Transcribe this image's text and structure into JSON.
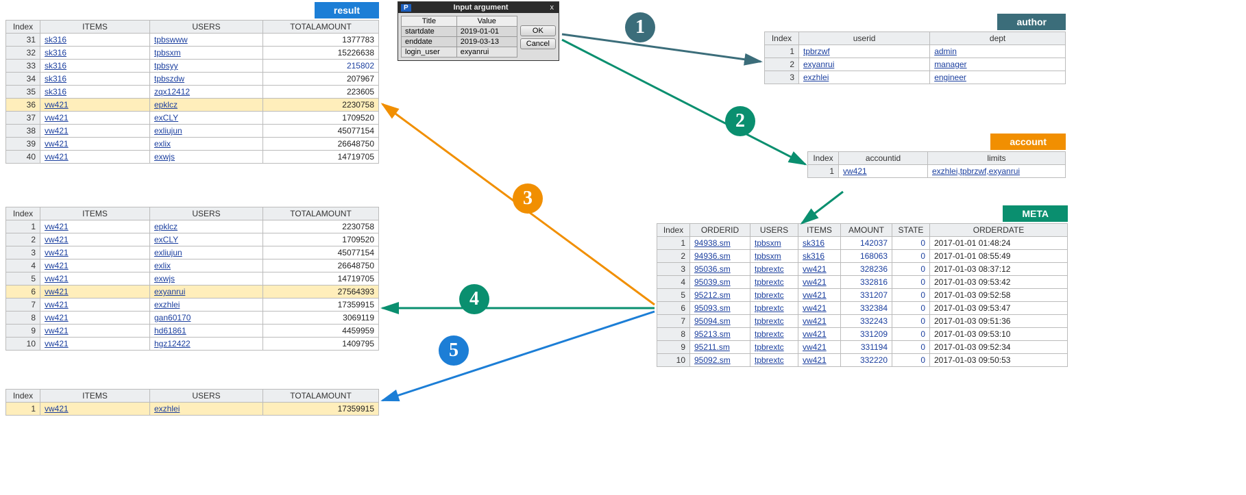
{
  "tags": {
    "result": "result",
    "author": "author",
    "account": "account",
    "meta": "META"
  },
  "dialog": {
    "title": "Input argument",
    "p": "P",
    "close": "x",
    "cols": [
      "Title",
      "Value"
    ],
    "rows": [
      {
        "title": "startdate",
        "value": "2019-01-01"
      },
      {
        "title": "enddate",
        "value": "2019-03-13"
      },
      {
        "title": "login_user",
        "value": "exyanrui"
      }
    ],
    "ok": "OK",
    "cancel": "Cancel"
  },
  "steps": {
    "s1": "1",
    "s2": "2",
    "s3": "3",
    "s4": "4",
    "s5": "5"
  },
  "resultA": {
    "cols": [
      "Index",
      "ITEMS",
      "USERS",
      "TOTALAMOUNT"
    ],
    "rows": [
      {
        "idx": "31",
        "items": "sk316",
        "users": "tpbswww",
        "amt": "1377783"
      },
      {
        "idx": "32",
        "items": "sk316",
        "users": "tpbsxm",
        "amt": "15226638"
      },
      {
        "idx": "33",
        "items": "sk316",
        "users": "tpbsyy",
        "amt": "215802",
        "blue": true
      },
      {
        "idx": "34",
        "items": "sk316",
        "users": "tpbszdw",
        "amt": "207967"
      },
      {
        "idx": "35",
        "items": "sk316",
        "users": "zqx12412",
        "amt": "223605"
      },
      {
        "idx": "36",
        "items": "vw421",
        "users": "epklcz",
        "amt": "2230758",
        "hl": true
      },
      {
        "idx": "37",
        "items": "vw421",
        "users": "exCLY",
        "amt": "1709520"
      },
      {
        "idx": "38",
        "items": "vw421",
        "users": "exliujun",
        "amt": "45077154"
      },
      {
        "idx": "39",
        "items": "vw421",
        "users": "exlix",
        "amt": "26648750"
      },
      {
        "idx": "40",
        "items": "vw421",
        "users": "exwjs",
        "amt": "14719705"
      }
    ]
  },
  "resultB": {
    "cols": [
      "Index",
      "ITEMS",
      "USERS",
      "TOTALAMOUNT"
    ],
    "rows": [
      {
        "idx": "1",
        "items": "vw421",
        "users": "epklcz",
        "amt": "2230758"
      },
      {
        "idx": "2",
        "items": "vw421",
        "users": "exCLY",
        "amt": "1709520"
      },
      {
        "idx": "3",
        "items": "vw421",
        "users": "exliujun",
        "amt": "45077154"
      },
      {
        "idx": "4",
        "items": "vw421",
        "users": "exlix",
        "amt": "26648750"
      },
      {
        "idx": "5",
        "items": "vw421",
        "users": "exwjs",
        "amt": "14719705"
      },
      {
        "idx": "6",
        "items": "vw421",
        "users": "exyanrui",
        "amt": "27564393",
        "hl": true
      },
      {
        "idx": "7",
        "items": "vw421",
        "users": "exzhlei",
        "amt": "17359915"
      },
      {
        "idx": "8",
        "items": "vw421",
        "users": "gan60170",
        "amt": "3069119"
      },
      {
        "idx": "9",
        "items": "vw421",
        "users": "hd61861",
        "amt": "4459959"
      },
      {
        "idx": "10",
        "items": "vw421",
        "users": "hgz12422",
        "amt": "1409795"
      }
    ]
  },
  "resultC": {
    "cols": [
      "Index",
      "ITEMS",
      "USERS",
      "TOTALAMOUNT"
    ],
    "rows": [
      {
        "idx": "1",
        "items": "vw421",
        "users": "exzhlei",
        "amt": "17359915",
        "hl": true
      }
    ]
  },
  "author": {
    "cols": [
      "Index",
      "userid",
      "dept"
    ],
    "rows": [
      {
        "idx": "1",
        "userid": "tpbrzwf",
        "dept": "admin"
      },
      {
        "idx": "2",
        "userid": "exyanrui",
        "dept": "manager"
      },
      {
        "idx": "3",
        "userid": "exzhlei",
        "dept": "engineer"
      }
    ]
  },
  "account": {
    "cols": [
      "Index",
      "accountid",
      "limits"
    ],
    "rows": [
      {
        "idx": "1",
        "accountid": "vw421",
        "limits": "exzhlei,tpbrzwf,exyanrui"
      }
    ]
  },
  "meta": {
    "cols": [
      "Index",
      "ORDERID",
      "USERS",
      "ITEMS",
      "AMOUNT",
      "STATE",
      "ORDERDATE"
    ],
    "rows": [
      {
        "idx": "1",
        "orderid": "94938.sm",
        "users": "tpbsxm",
        "items": "sk316",
        "amount": "142037",
        "state": "0",
        "date": "2017-01-01 01:48:24"
      },
      {
        "idx": "2",
        "orderid": "94936.sm",
        "users": "tpbsxm",
        "items": "sk316",
        "amount": "168063",
        "state": "0",
        "date": "2017-01-01 08:55:49"
      },
      {
        "idx": "3",
        "orderid": "95036.sm",
        "users": "tpbrextc",
        "items": "vw421",
        "amount": "328236",
        "state": "0",
        "date": "2017-01-03 08:37:12"
      },
      {
        "idx": "4",
        "orderid": "95039.sm",
        "users": "tpbrextc",
        "items": "vw421",
        "amount": "332816",
        "state": "0",
        "date": "2017-01-03 09:53:42"
      },
      {
        "idx": "5",
        "orderid": "95212.sm",
        "users": "tpbrextc",
        "items": "vw421",
        "amount": "331207",
        "state": "0",
        "date": "2017-01-03 09:52:58"
      },
      {
        "idx": "6",
        "orderid": "95093.sm",
        "users": "tpbrextc",
        "items": "vw421",
        "amount": "332384",
        "state": "0",
        "date": "2017-01-03 09:53:47"
      },
      {
        "idx": "7",
        "orderid": "95094.sm",
        "users": "tpbrextc",
        "items": "vw421",
        "amount": "332243",
        "state": "0",
        "date": "2017-01-03 09:51:36"
      },
      {
        "idx": "8",
        "orderid": "95213.sm",
        "users": "tpbrextc",
        "items": "vw421",
        "amount": "331209",
        "state": "0",
        "date": "2017-01-03 09:53:10"
      },
      {
        "idx": "9",
        "orderid": "95211.sm",
        "users": "tpbrextc",
        "items": "vw421",
        "amount": "331194",
        "state": "0",
        "date": "2017-01-03 09:52:34"
      },
      {
        "idx": "10",
        "orderid": "95092.sm",
        "users": "tpbrextc",
        "items": "vw421",
        "amount": "332220",
        "state": "0",
        "date": "2017-01-03 09:50:53"
      }
    ]
  }
}
